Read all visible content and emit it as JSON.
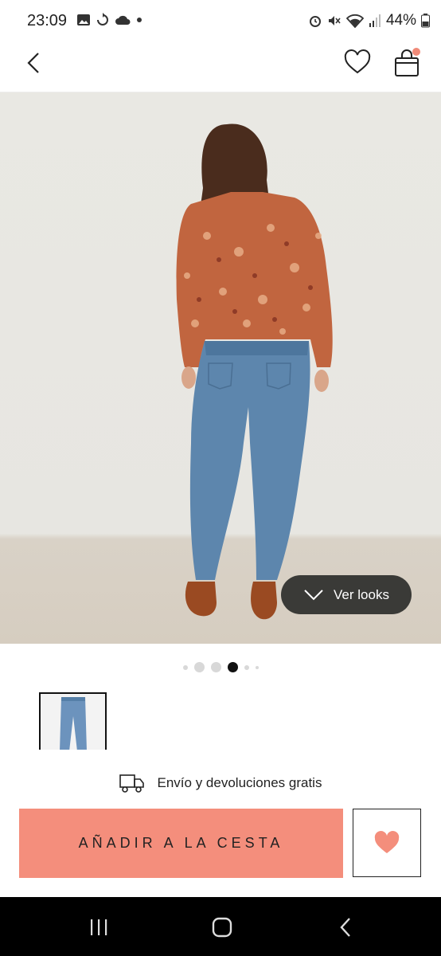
{
  "status_bar": {
    "time": "23:09",
    "left_icons": [
      "image-icon",
      "sync-icon",
      "cloud-icon",
      "dot-icon"
    ],
    "right_icons": [
      "alarm-icon",
      "mute-icon",
      "wifi-icon",
      "signal-icon"
    ],
    "battery": "44%"
  },
  "header": {
    "back_icon": "chevron-left-icon",
    "wishlist_icon": "heart-outline-icon",
    "bag_icon": "shopping-bag-icon",
    "bag_badge_color": "#f08a78"
  },
  "gallery": {
    "ver_looks_label": "Ver looks",
    "dots_count": 6,
    "active_dot": 3
  },
  "shipping": {
    "icon": "truck-icon",
    "text": "Envío y devoluciones gratis"
  },
  "actions": {
    "add_to_cart_label": "AÑADIR A LA CESTA",
    "add_to_cart_color": "#f48e7c",
    "favorite_icon": "heart-filled-icon",
    "favorite_color": "#f48e7c"
  },
  "nav_bar": {
    "buttons": [
      "recents-icon",
      "home-icon",
      "back-icon"
    ]
  }
}
